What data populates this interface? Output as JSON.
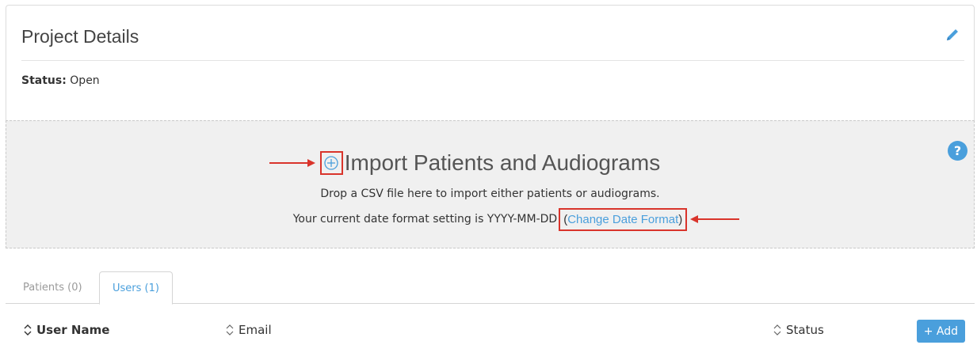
{
  "project": {
    "title": "Project Details",
    "status_label": "Status:",
    "status_value": "Open"
  },
  "import": {
    "title": "Import Patients and Audiograms",
    "drop_text": "Drop a CSV file here to import either patients or audiograms.",
    "date_prefix": "Your current date format setting is YYYY-MM-DD",
    "open_paren": "(",
    "change_link": "Change Date Format",
    "close_paren": ")",
    "help": "?"
  },
  "tabs": [
    {
      "label": "Patients (0)",
      "active": false
    },
    {
      "label": "Users (1)",
      "active": true
    }
  ],
  "table": {
    "columns": [
      "User Name",
      "Email",
      "Status"
    ],
    "add_label": "+ Add"
  },
  "colors": {
    "accent": "#4a9fdc",
    "annotation": "#d9342b",
    "dropzone_bg": "#f0f0f0"
  }
}
